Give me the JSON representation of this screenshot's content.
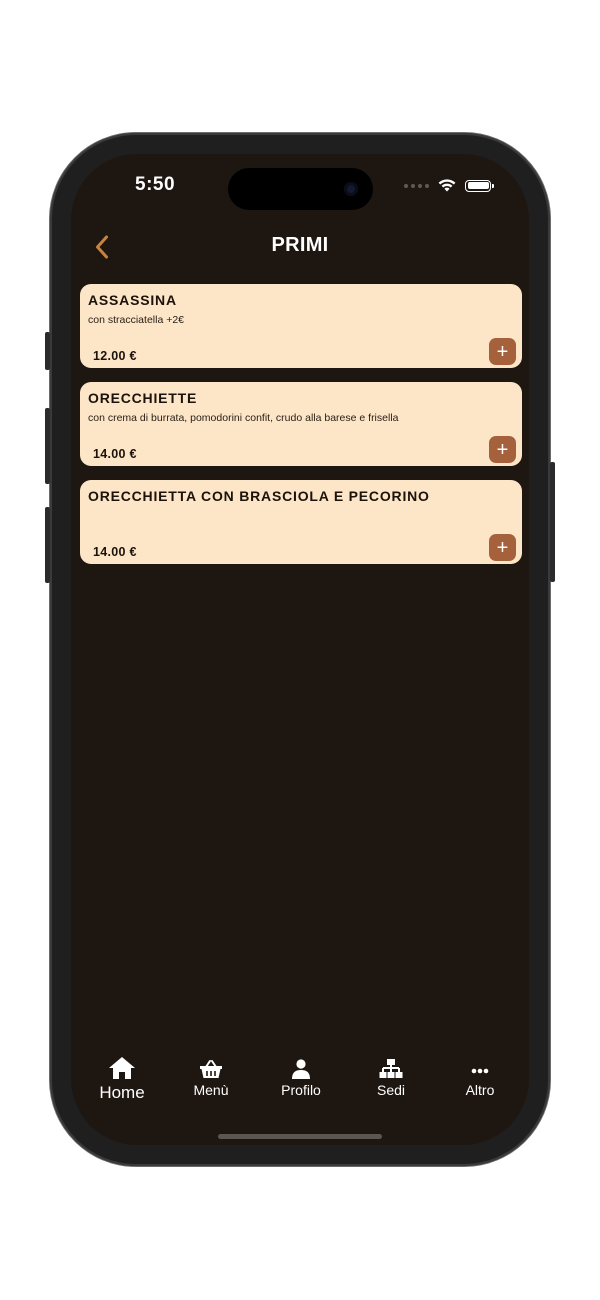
{
  "status_bar": {
    "time": "5:50"
  },
  "header": {
    "title": "PRIMI",
    "back_icon": "chevron-left-icon"
  },
  "colors": {
    "background": "#1e1611",
    "card": "#fde6c7",
    "accent": "#a5613b",
    "back": "#c8843e"
  },
  "items": [
    {
      "name": "ASSASSINA",
      "description": "con stracciatella +2€",
      "price": "12.00 €",
      "add_label": "+"
    },
    {
      "name": "ORECCHIETTE",
      "description": "con crema di burrata, pomodorini confit, crudo alla barese e frisella",
      "price": "14.00 €",
      "add_label": "+"
    },
    {
      "name": "ORECCHIETTA CON BRASCIOLA E PECORINO",
      "description": "",
      "price": "14.00 €",
      "add_label": "+"
    }
  ],
  "tabbar": {
    "tabs": [
      {
        "label": "Home",
        "icon": "home-icon",
        "active": true
      },
      {
        "label": "Menù",
        "icon": "basket-icon",
        "active": false
      },
      {
        "label": "Profilo",
        "icon": "user-icon",
        "active": false
      },
      {
        "label": "Sedi",
        "icon": "network-icon",
        "active": false
      },
      {
        "label": "Altro",
        "icon": "more-icon",
        "active": false
      }
    ]
  }
}
